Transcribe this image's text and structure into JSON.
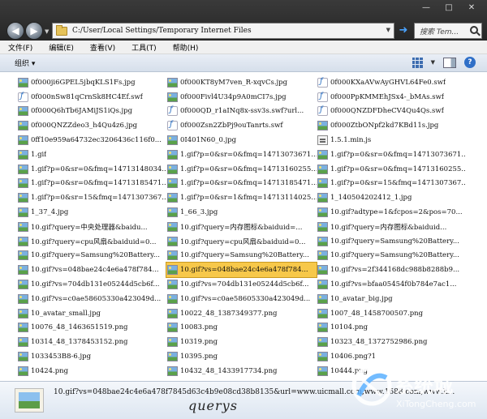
{
  "window": {
    "controls": {
      "minimize": "—",
      "maximize": "□",
      "close": "✕"
    }
  },
  "nav": {
    "back_glyph": "◀",
    "forward_glyph": "▶",
    "address": "C:/User/Local Settings/Temporary Internet Files",
    "go_glyph": "➜",
    "search_placeholder": "搜索 Tem..."
  },
  "menu": {
    "items": [
      "文件(F)",
      "编辑(E)",
      "查看(V)",
      "工具(T)",
      "帮助(H)"
    ]
  },
  "toolbar": {
    "organize": "组织 ▾"
  },
  "files": [
    {
      "name": "0f000ji6GPEL5jbqKLS1Fs.jpg",
      "type": "image"
    },
    {
      "name": "0f000KT8yM7ven_R-xqvCs.jpg",
      "type": "image"
    },
    {
      "name": "0f000KXaAVwAyGHVL64Fe0.swf",
      "type": "swf"
    },
    {
      "name": "0f000nSw81qCrnSk8HC4Ef.swf",
      "type": "swf"
    },
    {
      "name": "0f000Fivl4U34p9A0mCI7s.jpg",
      "type": "image"
    },
    {
      "name": "0f000PpKMMEhJSx4-_bMAs.swf",
      "type": "swf"
    },
    {
      "name": "0f000Q6hTb6JAMiJS1iQs.jpg",
      "type": "image"
    },
    {
      "name": "0f000QD_r1aINq8x-ssv3s.swf?url...",
      "type": "swf"
    },
    {
      "name": "0f000QNZDFDheCV4Qu4Qs.swf",
      "type": "swf"
    },
    {
      "name": "0f000QNZZdeo3_h4Qu4z6.jpg",
      "type": "image"
    },
    {
      "name": "0f000Zsn2ZbPj9ouTanrts.swf",
      "type": "swf"
    },
    {
      "name": "0f000ZtbONpf2kd7KBd11s.jpg",
      "type": "image"
    },
    {
      "name": "0ff10e959a64732ec3206436c116f0...",
      "type": "image"
    },
    {
      "name": "0I401N60_0.jpg",
      "type": "image"
    },
    {
      "name": "1.5.1.min.js",
      "type": "js"
    },
    {
      "name": "1.gif",
      "type": "image"
    },
    {
      "name": "1.gif?p=0&sr=0&fmq=14713073671...",
      "type": "image"
    },
    {
      "name": "1.gif?p=0&sr=0&fmq=14713073671...",
      "type": "image"
    },
    {
      "name": "1.gif?p=0&sr=0&fmq=14713148034...",
      "type": "image"
    },
    {
      "name": "1.gif?p=0&sr=0&fmq=14713160255...",
      "type": "image"
    },
    {
      "name": "1.gif?p=0&sr=0&fmq=14713160255...",
      "type": "image"
    },
    {
      "name": "1.gif?p=0&sr=0&fmq=14713185471...",
      "type": "image"
    },
    {
      "name": "1.gif?p=0&sr=0&fmq=14713185471...",
      "type": "image"
    },
    {
      "name": "1.gif?p=0&sr=15&fmq=1471307367...",
      "type": "image"
    },
    {
      "name": "1.gif?p=0&sr=15&fmq=1471307367...",
      "type": "image"
    },
    {
      "name": "1.gif?p=0&sr=1&fmq=14713114025...",
      "type": "image"
    },
    {
      "name": "1_140504202412_1.jpg",
      "type": "image"
    },
    {
      "name": "1_37_4.jpg",
      "type": "image"
    },
    {
      "name": "1_66_3.jpg",
      "type": "image"
    },
    {
      "name": "10.gif?adtype=1&fcpos=2&pos=70...",
      "type": "image"
    },
    {
      "name": "10.gif?query=中央处理器&baidu...",
      "type": "image"
    },
    {
      "name": "10.gif?query=内存图标&baiduid=...",
      "type": "image"
    },
    {
      "name": "10.gif?query=内存图标&baiduid...",
      "type": "image"
    },
    {
      "name": "10.gif?query=cpu风扇&baiduid=0...",
      "type": "image"
    },
    {
      "name": "10.gif?query=cpu风扇&baiduid=0...",
      "type": "image"
    },
    {
      "name": "10.gif?query=Samsung%20Battery...",
      "type": "image"
    },
    {
      "name": "10.gif?query=Samsung%20Battery...",
      "type": "image"
    },
    {
      "name": "10.gif?query=Samsung%20Battery...",
      "type": "image"
    },
    {
      "name": "10.gif?query=Samsung%20Battery...",
      "type": "image"
    },
    {
      "name": "10.gif?vs=048bae24c4e6a478f784...",
      "type": "image"
    },
    {
      "name": "10.gif?vs=048bae24c4e6a478f784...",
      "type": "image",
      "selected": true
    },
    {
      "name": "10.gif?vs=2f344168dc988b8288b9...",
      "type": "image"
    },
    {
      "name": "10.gif?vs=704db131e05244d5cb6f...",
      "type": "image"
    },
    {
      "name": "10.gif?vs=704db131e05244d5cb6f...",
      "type": "image"
    },
    {
      "name": "10.gif?vs=bfaa05454f0b784e7ac1...",
      "type": "image"
    },
    {
      "name": "10.gif?vs=c0ae58605330a423049d...",
      "type": "image"
    },
    {
      "name": "10.gif?vs=c0ae58605330a423049d...",
      "type": "image"
    },
    {
      "name": "10_avatar_big.jpg",
      "type": "image"
    },
    {
      "name": "10_avatar_small.jpg",
      "type": "image"
    },
    {
      "name": "10022_48_1387349377.png",
      "type": "image"
    },
    {
      "name": "1007_48_1458700507.png",
      "type": "image"
    },
    {
      "name": "10076_48_1463651519.png",
      "type": "image"
    },
    {
      "name": "10083.png",
      "type": "image"
    },
    {
      "name": "10104.png",
      "type": "image"
    },
    {
      "name": "10314_48_1378453152.png",
      "type": "image"
    },
    {
      "name": "10319.png",
      "type": "image"
    },
    {
      "name": "10323_48_1372752986.png",
      "type": "image"
    },
    {
      "name": "1033453B8-6.jpg",
      "type": "image"
    },
    {
      "name": "10395.png",
      "type": "image"
    },
    {
      "name": "10406.png?1",
      "type": "image"
    },
    {
      "name": "10424.png",
      "type": "image"
    },
    {
      "name": "10432_48_1433917734.png",
      "type": "image"
    },
    {
      "name": "10444.png",
      "type": "image"
    },
    {
      "name": "10464.png",
      "type": "image"
    },
    {
      "name": "10469.png?1",
      "type": "image"
    },
    {
      "name": "10488.png",
      "type": "image"
    }
  ],
  "details": {
    "filename": "10.gif?vs=048bae24c4e6a478f7845d63c4b9e08cd38b8135&url=www.uicmall.com,www.1688.com,www.k..."
  }
}
